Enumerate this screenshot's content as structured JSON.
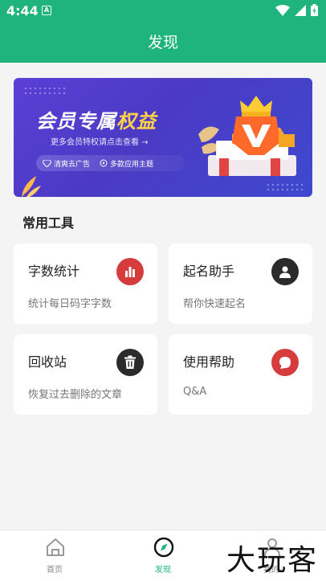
{
  "status": {
    "time": "4:44",
    "notice_glyph": "A"
  },
  "header": {
    "title": "发现"
  },
  "banner": {
    "title_main": "会员专属",
    "title_highlight": "权益",
    "subtitle": "更多会员特权请点击查看 →",
    "tags": [
      "清爽去广告",
      "多款应用主题"
    ]
  },
  "section": {
    "title": "常用工具"
  },
  "tools": [
    {
      "title": "字数统计",
      "desc": "统计每日码字字数",
      "icon": "bar-chart-icon",
      "color": "#d63c3c"
    },
    {
      "title": "起名助手",
      "desc": "帮你快速起名",
      "icon": "person-icon",
      "color": "#2b2b2b"
    },
    {
      "title": "回收站",
      "desc": "恢复过去删除的文章",
      "icon": "trash-icon",
      "color": "#2b2b2b"
    },
    {
      "title": "使用帮助",
      "desc": "Q&A",
      "icon": "chat-icon",
      "color": "#d63c3c"
    }
  ],
  "nav": {
    "items": [
      {
        "label": "首页",
        "icon": "home-icon"
      },
      {
        "label": "发现",
        "icon": "compass-icon"
      },
      {
        "label": "我的",
        "icon": "user-icon"
      }
    ],
    "active_color": "#1fb37e"
  },
  "watermark": "大玩客",
  "colors": {
    "primary": "#1fb37e",
    "banner": "#4b3ac4"
  }
}
